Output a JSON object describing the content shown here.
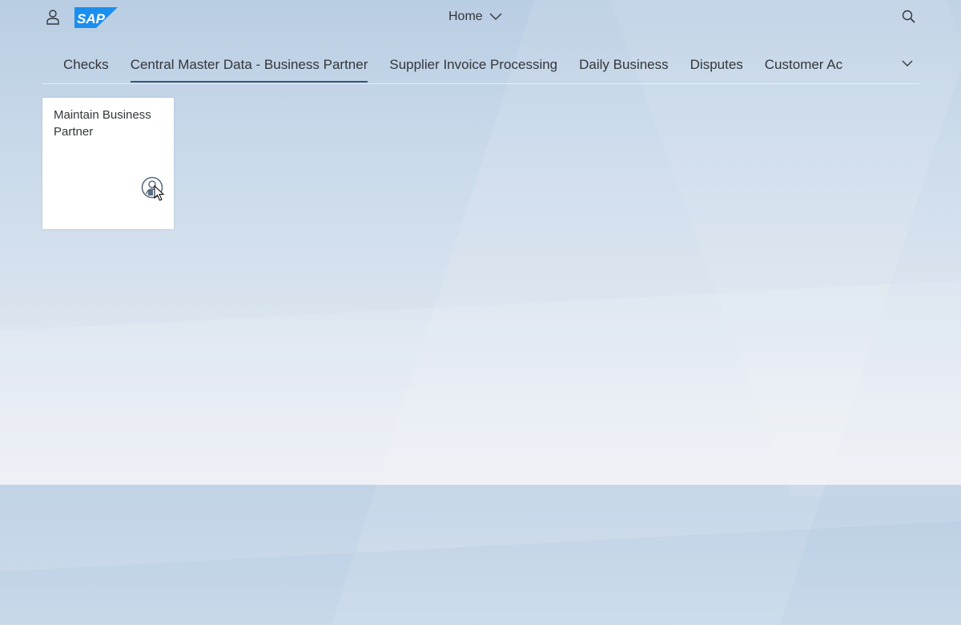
{
  "shell": {
    "user_icon": "person-icon",
    "logo_text": "SAP",
    "home_label": "Home",
    "home_chevron_icon": "chevron-down-icon",
    "search_icon": "search-icon"
  },
  "tabs": [
    {
      "label": "Checks",
      "active": false
    },
    {
      "label": "Central Master Data - Business Partner",
      "active": true
    },
    {
      "label": "Supplier Invoice Processing",
      "active": false
    },
    {
      "label": "Daily Business",
      "active": false
    },
    {
      "label": "Disputes",
      "active": false
    },
    {
      "label": "Customer Ac",
      "active": false
    }
  ],
  "tabs_overflow_icon": "chevron-down-icon",
  "tile": {
    "title": "Maintain Business Partner",
    "icon": "business-partner-icon"
  },
  "colors": {
    "sap_blue": "#1b8ff0",
    "active_tab_underline": "#35557a",
    "text": "#32363a"
  }
}
